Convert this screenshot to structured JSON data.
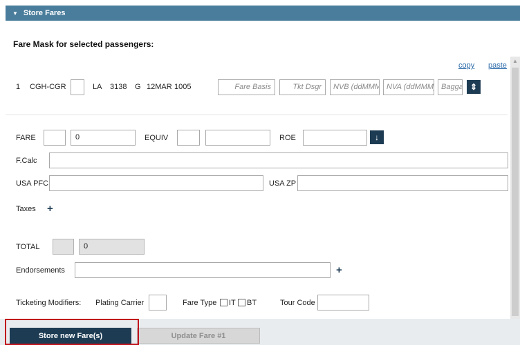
{
  "section": {
    "title": "Store Fares"
  },
  "mask_title": "Fare Mask for selected passengers:",
  "links": {
    "copy": "copy",
    "paste": "paste"
  },
  "segment": {
    "number": "1",
    "route": "CGH-CGR",
    "carrier": "LA",
    "flight": "3138",
    "class": "G",
    "date": "12MAR",
    "time": "1005",
    "placeholders": {
      "fare_basis": "Fare Basis",
      "tkt_dsgr": "Tkt Dsgr",
      "nvb": "NVB (ddMMM)",
      "nva": "NVA (ddMMM)",
      "baggage": "Baggage"
    }
  },
  "fare": {
    "label": "FARE",
    "amount": "0",
    "equiv_label": "EQUIV",
    "roe_label": "ROE"
  },
  "fcalc_label": "F.Calc",
  "usa_pfc_label": "USA PFC",
  "usa_zp_label": "USA ZP",
  "taxes_label": "Taxes",
  "total": {
    "label": "TOTAL",
    "amount": "0"
  },
  "endorsements_label": "Endorsements",
  "ticketing": {
    "label": "Ticketing Modifiers:",
    "plating_carrier": "Plating Carrier",
    "fare_type": "Fare Type",
    "it": "IT",
    "bt": "BT",
    "tour_code": "Tour Code"
  },
  "buttons": {
    "store": "Store new Fare(s)",
    "update": "Update Fare #1"
  },
  "icons": {
    "collapse": "triangle-down-icon",
    "sort": "up-down-arrow-icon",
    "down": "arrow-down-icon",
    "add": "plus-icon"
  },
  "colors": {
    "header": "#4a7d9c",
    "primary": "#1d3c54",
    "highlight": "#c0141c"
  }
}
